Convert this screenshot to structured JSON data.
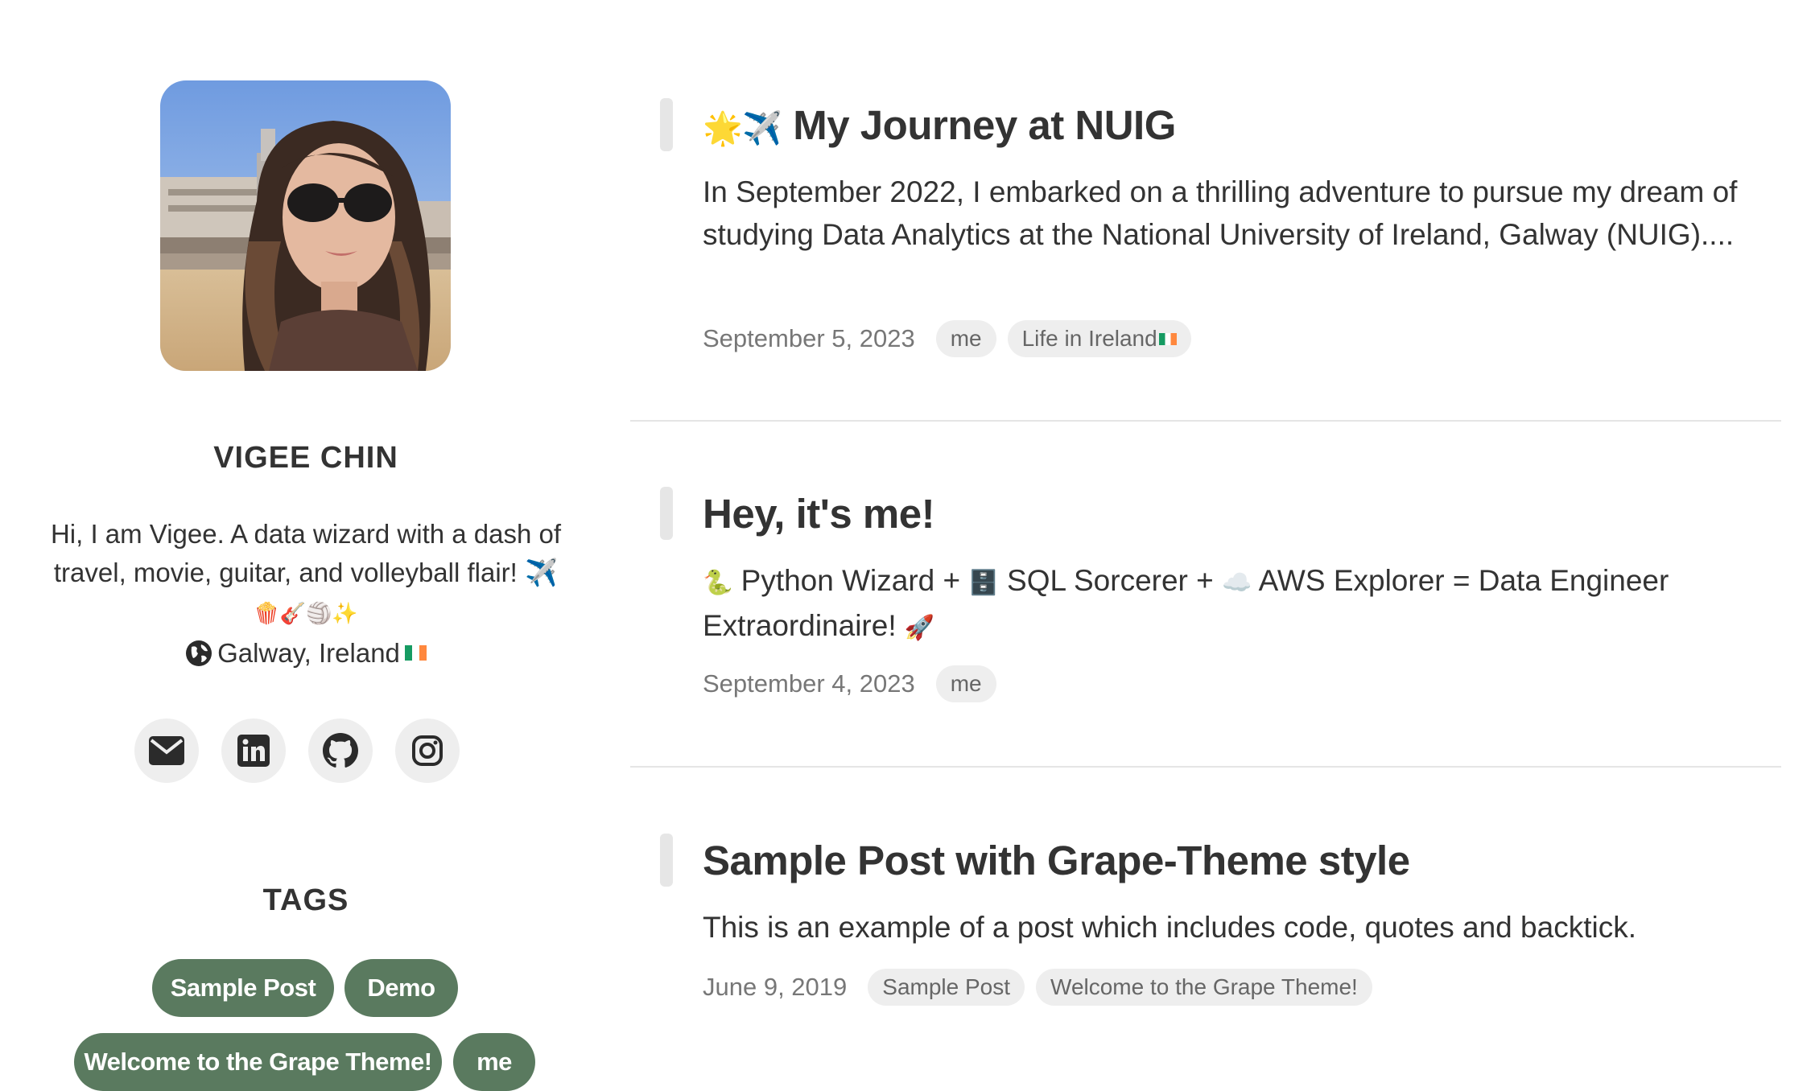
{
  "profile": {
    "name": "VIGEE CHIN",
    "bio_text": "Hi, I am Vigee. A data wizard with a dash of travel, movie, guitar, and volleyball flair! ✈️",
    "bio_emoji": "🍿🎸🏐✨",
    "location": "Galway, Ireland",
    "location_flag": "Ireland flag"
  },
  "socials": [
    {
      "name": "email",
      "icon": "envelope-icon"
    },
    {
      "name": "linkedin",
      "icon": "linkedin-icon"
    },
    {
      "name": "github",
      "icon": "github-icon"
    },
    {
      "name": "instagram",
      "icon": "instagram-icon"
    }
  ],
  "tags_section": {
    "title": "TAGS",
    "tags": [
      "Sample Post",
      "Demo",
      "Welcome to the Grape Theme!",
      "me"
    ]
  },
  "posts": [
    {
      "title_emoji": "🌟✈️",
      "title": "My Journey at NUIG",
      "excerpt": "In September 2022, I embarked on a thrilling adventure to pursue my dream of studying Data Analytics at the National University of Ireland, Galway (NUIG)....",
      "date": "September 5, 2023",
      "tags": [
        "me",
        "Life in Ireland"
      ]
    },
    {
      "title": "Hey, it's me!",
      "excerpt_parts": [
        "🐍",
        " Python Wizard + ",
        "🗄️",
        " SQL Sorcerer + ",
        "☁️",
        " AWS Explorer = Data Engineer Extraordinaire! ",
        "🚀"
      ],
      "date": "September 4, 2023",
      "tags": [
        "me"
      ]
    },
    {
      "title": "Sample Post with Grape-Theme style",
      "excerpt": "This is an example of a post which includes code, quotes and backtick.",
      "date": "June 9, 2019",
      "tags": [
        "Sample Post",
        "Welcome to the Grape Theme!"
      ]
    }
  ],
  "colors": {
    "tag_green": "#5a7a5f",
    "pill_gray": "#eeeeee",
    "text": "#333333",
    "muted": "#777777"
  }
}
